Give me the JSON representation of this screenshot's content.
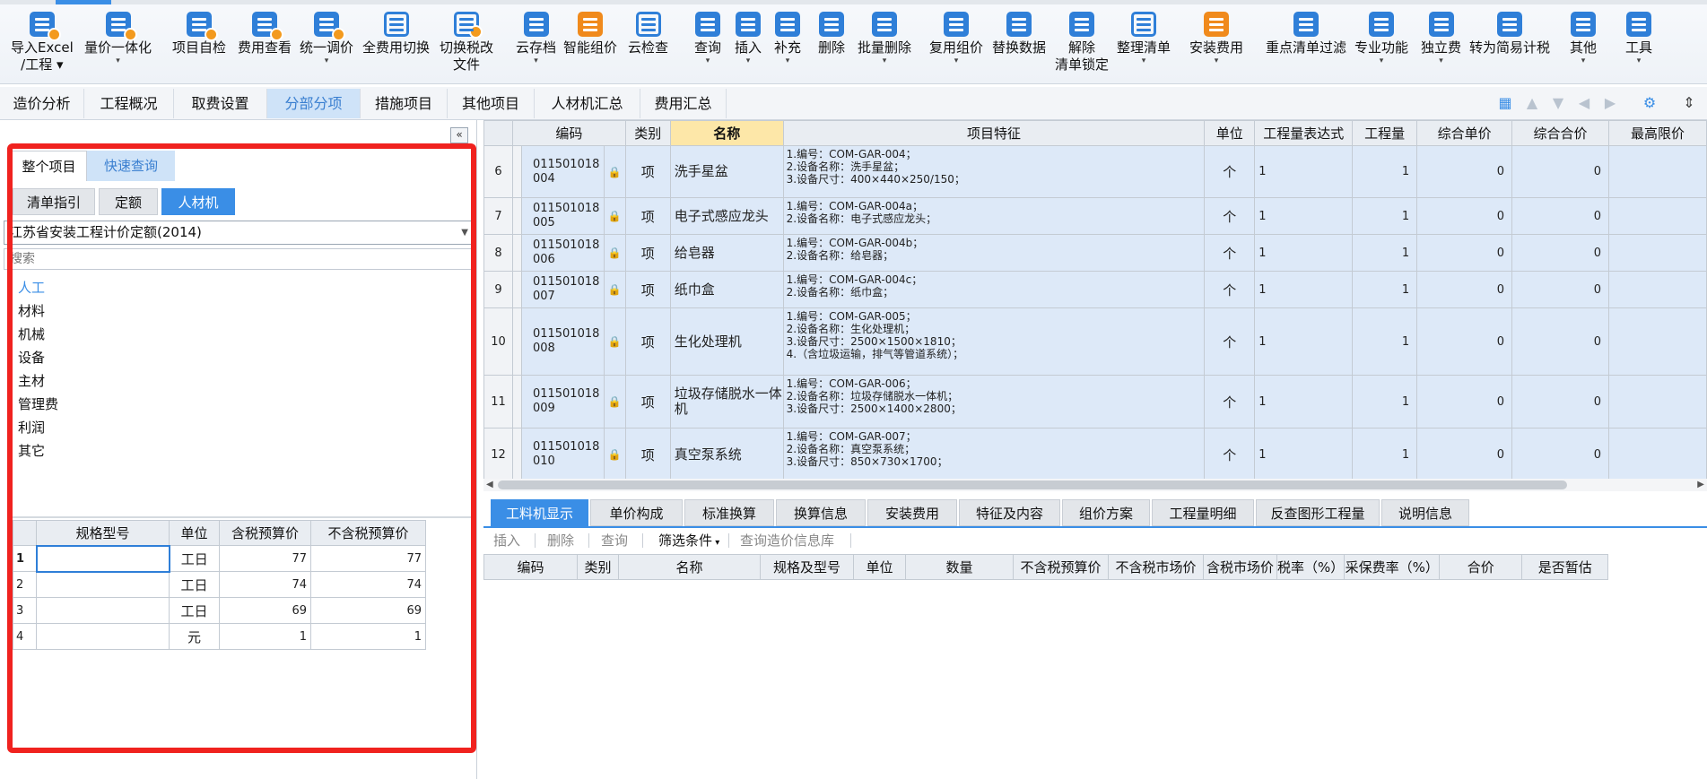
{
  "toolbar": {
    "buttons": [
      {
        "label": "导入Excel",
        "label2": "/工程",
        "icon": "import-excel-icon"
      },
      {
        "label": "量价一体化",
        "icon": "qty-price-icon"
      },
      {
        "label": "项目自检",
        "icon": "self-check-icon"
      },
      {
        "label": "费用查看",
        "icon": "fee-view-icon"
      },
      {
        "label": "统一调价",
        "icon": "adjust-price-icon"
      },
      {
        "label": "全费用切换",
        "icon": "full-fee-icon"
      },
      {
        "label": "切换税改",
        "label2": "文件",
        "icon": "tax-switch-icon"
      },
      {
        "label": "云存档",
        "icon": "cloud-save-icon"
      },
      {
        "label": "智能组价",
        "icon": "smart-price-icon"
      },
      {
        "label": "云检查",
        "icon": "cloud-check-icon"
      },
      {
        "label": "查询",
        "icon": "query-icon"
      },
      {
        "label": "插入",
        "icon": "insert-icon"
      },
      {
        "label": "补充",
        "icon": "supplement-icon"
      },
      {
        "label": "删除",
        "icon": "delete-icon"
      },
      {
        "label": "批量删除",
        "icon": "batch-delete-icon"
      },
      {
        "label": "复用组价",
        "icon": "reuse-price-icon"
      },
      {
        "label": "替换数据",
        "icon": "replace-data-icon"
      },
      {
        "label": "解除",
        "label2": "清单锁定",
        "icon": "unlock-icon"
      },
      {
        "label": "整理清单",
        "icon": "organize-list-icon"
      },
      {
        "label": "安装费用",
        "icon": "install-fee-icon"
      },
      {
        "label": "重点清单过滤",
        "icon": "key-filter-icon"
      },
      {
        "label": "专业功能",
        "icon": "pro-function-icon"
      },
      {
        "label": "独立费",
        "icon": "independent-fee-icon"
      },
      {
        "label": "转为简易计税",
        "icon": "simple-tax-icon"
      },
      {
        "label": "其他",
        "icon": "other-icon"
      },
      {
        "label": "工具",
        "icon": "tools-icon"
      }
    ]
  },
  "tabs": [
    "造价分析",
    "工程概况",
    "取费设置",
    "分部分项",
    "措施项目",
    "其他项目",
    "人材机汇总",
    "费用汇总"
  ],
  "left": {
    "top_tabs": [
      "整个项目",
      "快速查询"
    ],
    "sub_tabs": [
      "清单指引",
      "定额",
      "人材机"
    ],
    "quota_select": "江苏省安装工程计价定额(2014)",
    "search_placeholder": "搜索",
    "categories": [
      "人工",
      "材料",
      "机械",
      "设备",
      "主材",
      "管理费",
      "利润",
      "其它"
    ],
    "table": {
      "columns": [
        "规格型号",
        "单位",
        "含税预算价",
        "不含税预算价"
      ],
      "rows": [
        {
          "n": "1",
          "spec": "",
          "unit": "工日",
          "tax": "77",
          "notax": "77"
        },
        {
          "n": "2",
          "spec": "",
          "unit": "工日",
          "tax": "74",
          "notax": "74"
        },
        {
          "n": "3",
          "spec": "",
          "unit": "工日",
          "tax": "69",
          "notax": "69"
        },
        {
          "n": "4",
          "spec": "",
          "unit": "元",
          "tax": "1",
          "notax": "1"
        }
      ]
    }
  },
  "main": {
    "columns": [
      "编码",
      "类别",
      "名称",
      "项目特征",
      "单位",
      "工程量表达式",
      "工程量",
      "综合单价",
      "综合合价",
      "最高限价"
    ],
    "rows": [
      {
        "n": "6",
        "code": "011501018004",
        "type": "项",
        "name": "洗手星盆",
        "feat": "1.编号：COM-GAR-004；\n2.设备名称：洗手星盆；\n3.设备尺寸：400×440×250/150；",
        "unit": "个",
        "expr": "1",
        "qty": "1",
        "up": "0",
        "tp": "0"
      },
      {
        "n": "7",
        "code": "011501018005",
        "type": "项",
        "name": "电子式感应龙头",
        "feat": "1.编号：COM-GAR-004a；\n2.设备名称：电子式感应龙头；",
        "unit": "个",
        "expr": "1",
        "qty": "1",
        "up": "0",
        "tp": "0"
      },
      {
        "n": "8",
        "code": "011501018006",
        "type": "项",
        "name": "给皂器",
        "feat": "1.编号：COM-GAR-004b；\n2.设备名称：给皂器；",
        "unit": "个",
        "expr": "1",
        "qty": "1",
        "up": "0",
        "tp": "0"
      },
      {
        "n": "9",
        "code": "011501018007",
        "type": "项",
        "name": "纸巾盒",
        "feat": "1.编号：COM-GAR-004c；\n2.设备名称：纸巾盒；",
        "unit": "个",
        "expr": "1",
        "qty": "1",
        "up": "0",
        "tp": "0"
      },
      {
        "n": "10",
        "code": "011501018008",
        "type": "项",
        "name": "生化处理机",
        "feat": "1.编号：COM-GAR-005；\n2.设备名称：生化处理机；\n3.设备尺寸：2500×1500×1810；\n4.（含垃圾运输，排气等管道系统）；",
        "unit": "个",
        "expr": "1",
        "qty": "1",
        "up": "0",
        "tp": "0"
      },
      {
        "n": "11",
        "code": "011501018009",
        "type": "项",
        "name": "垃圾存储脱水一体机",
        "feat": "1.编号：COM-GAR-006；\n2.设备名称：垃圾存储脱水一体机；\n3.设备尺寸：2500×1400×2800；",
        "unit": "个",
        "expr": "1",
        "qty": "1",
        "up": "0",
        "tp": "0"
      },
      {
        "n": "12",
        "code": "011501018010",
        "type": "项",
        "name": "真空泵系统",
        "feat": "1.编号：COM-GAR-007；\n2.设备名称：真空泵系统；\n3.设备尺寸：850×730×1700；",
        "unit": "个",
        "expr": "1",
        "qty": "1",
        "up": "0",
        "tp": "0"
      }
    ]
  },
  "bottom": {
    "tabs": [
      "工料机显示",
      "单价构成",
      "标准换算",
      "换算信息",
      "安装费用",
      "特征及内容",
      "组价方案",
      "工程量明细",
      "反查图形工程量",
      "说明信息"
    ],
    "tools": [
      "插入",
      "删除",
      "查询",
      "筛选条件",
      "查询造价信息库"
    ],
    "columns": [
      "编码",
      "类别",
      "名称",
      "规格及型号",
      "单位",
      "数量",
      "不含税预算价",
      "不含税市场价",
      "含税市场价",
      "税率（%）",
      "采保费率（%）",
      "合价",
      "是否暂估"
    ]
  },
  "colors": {
    "accent": "#3a8ee6",
    "highlight": "#f0221f",
    "row_bg": "#dde9f8"
  }
}
